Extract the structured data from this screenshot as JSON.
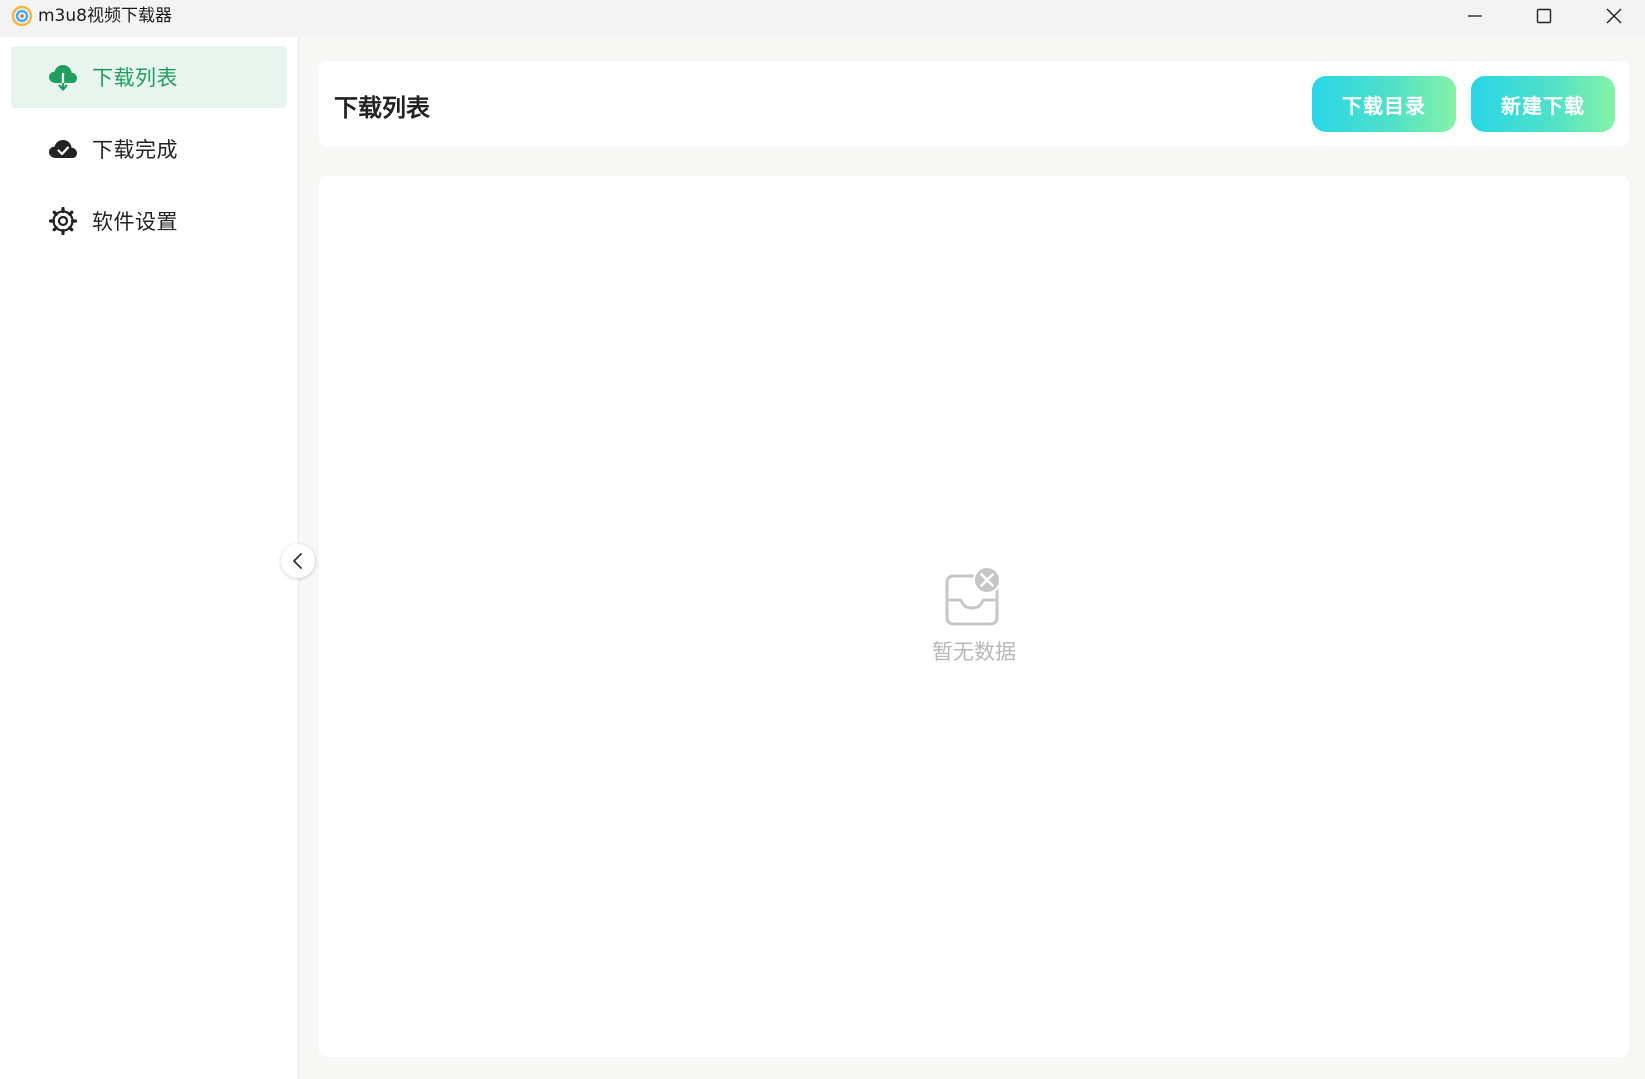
{
  "window": {
    "title": "m3u8视频下载器"
  },
  "sidebar": {
    "items": [
      {
        "label": "下载列表",
        "icon": "cloud-download-icon",
        "active": true
      },
      {
        "label": "下载完成",
        "icon": "cloud-check-icon",
        "active": false
      },
      {
        "label": "软件设置",
        "icon": "gear-icon",
        "active": false
      }
    ]
  },
  "header": {
    "title": "下载列表",
    "dir_button": "下载目录",
    "new_button": "新建下载"
  },
  "content": {
    "empty_text": "暂无数据"
  },
  "colors": {
    "accent": "#1f9e5e",
    "active_bg": "#e8f5ee",
    "gradient_start": "#28d6e6",
    "gradient_end": "#86f2a6"
  }
}
